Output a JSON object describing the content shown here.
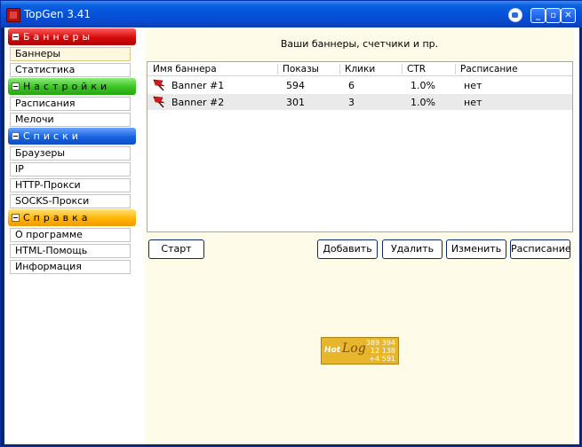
{
  "window": {
    "title": "TopGen 3.41"
  },
  "sidebar": {
    "groups": [
      {
        "label": "Баннеры",
        "items": [
          "Баннеры",
          "Статистика"
        ]
      },
      {
        "label": "Настройки",
        "items": [
          "Расписания",
          "Мелочи"
        ]
      },
      {
        "label": "Списки",
        "items": [
          "Браузеры",
          "IP",
          "HTTP-Прокси",
          "SOCKS-Прокси"
        ]
      },
      {
        "label": "Справка",
        "items": [
          "О программе",
          "HTML-Помощь",
          "Информация"
        ]
      }
    ],
    "selected": "Баннеры"
  },
  "main": {
    "title": "Ваши баннеры, счетчики и пр.",
    "table": {
      "columns": [
        "Имя баннера",
        "Показы",
        "Клики",
        "CTR",
        "Расписание"
      ],
      "rows": [
        [
          "Banner #1",
          "594",
          "6",
          "1.0%",
          "нет"
        ],
        [
          "Banner #2",
          "301",
          "3",
          "1.0%",
          "нет"
        ]
      ]
    },
    "buttons": {
      "start": "Старт",
      "add": "Добавить",
      "delete": "Удалить",
      "edit": "Изменить",
      "schedule": "Расписание"
    }
  },
  "counter": {
    "brand": "Hot",
    "brand2": "Log",
    "line1": "389 394",
    "line2": "12 138",
    "line3": "+4 591"
  },
  "colors": {
    "titlebar": "#0550d8",
    "banners_group": "#d40c0c",
    "settings_group": "#37c31f",
    "lists_group": "#1a63e0",
    "help_group": "#ffb400"
  }
}
